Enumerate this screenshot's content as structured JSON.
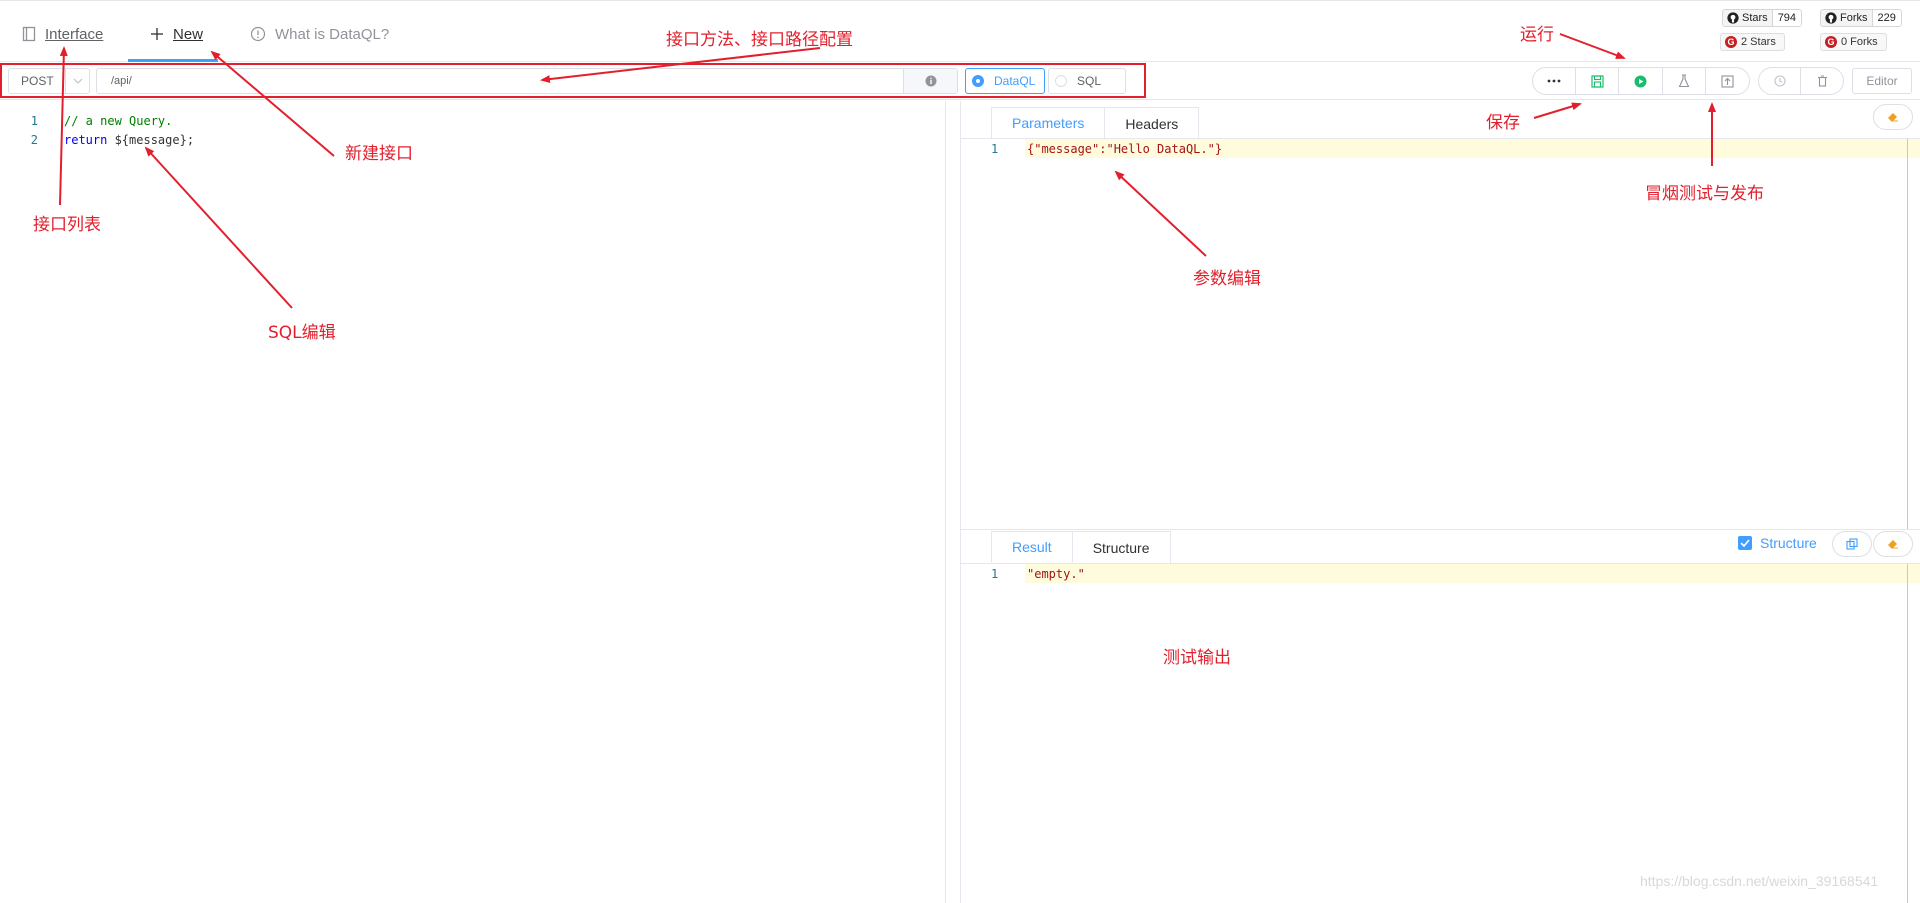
{
  "top_tabs": {
    "interface": "Interface",
    "new": "New",
    "what_is": "What is DataQL?"
  },
  "badges": {
    "github_stars_label": "Stars",
    "github_stars_count": "794",
    "github_forks_label": "Forks",
    "github_forks_count": "229",
    "gitee_stars": "2 Stars",
    "gitee_forks": "0 Forks"
  },
  "toolbar": {
    "method": "POST",
    "path": "/api/",
    "mode_dataql": "DataQL",
    "mode_sql": "SQL",
    "editor_button": "Editor"
  },
  "editor": {
    "lines": [
      {
        "num": "1",
        "text": "// a new Query."
      },
      {
        "num": "2",
        "keyword": "return",
        "text": " ${message};"
      }
    ]
  },
  "params_panel": {
    "tabs": [
      "Parameters",
      "Headers"
    ],
    "line_num": "1",
    "content": "{\"message\":\"Hello DataQL.\"}"
  },
  "result_panel": {
    "tabs": [
      "Result",
      "Structure"
    ],
    "structure_checkbox": "Structure",
    "line_num": "1",
    "content": "\"empty.\""
  },
  "annotations": {
    "method_path": "接口方法、接口路径配置",
    "new_api": "新建接口",
    "api_list": "接口列表",
    "sql_edit": "SQL编辑",
    "run": "运行",
    "save": "保存",
    "smoke_publish": "冒烟测试与发布",
    "param_edit": "参数编辑",
    "test_output": "测试输出"
  },
  "watermark": "https://blog.csdn.net/weixin_39168541",
  "colors": {
    "accent": "#409eff",
    "annotation_red": "#e2202d",
    "run_green": "#19be6b"
  }
}
